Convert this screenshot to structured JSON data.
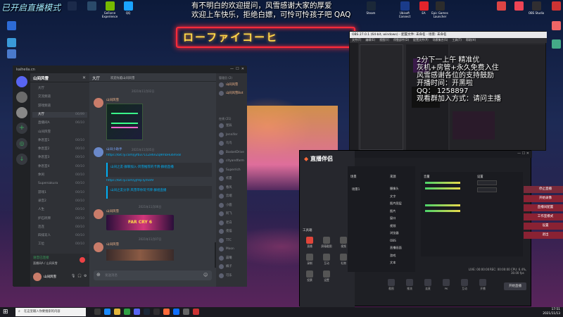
{
  "overlay": {
    "top_left": "已开启直播模式",
    "line1": "有不明白的欢迎提问，风雪感谢大家的厚爱",
    "line2": "欢迎上车快乐，拒绝白嫖，可怜可怜孩子吧 QAQ",
    "right": [
      "2分下一上午 精准优",
      "灰机+房管+永久免费入住",
      "风雪感谢各位的支持鼓励",
      "开播时间：开黑啦",
      "QQ：  1258897",
      "观看群加入方式：请问主播"
    ]
  },
  "desktop_icons": [
    "Steam",
    "Ubisoft Connect",
    "EA",
    "Epic Games Launcher",
    "OBS Studio",
    "GeForce Experience",
    "QQ"
  ],
  "neon_sign": "ローファイコーヒ",
  "discord": {
    "window_title": "kaiheila.cn",
    "server_name": "山间风雪",
    "channel_header": "大厅",
    "channel_topic": "欢迎光临山间风雪",
    "channels": [
      {
        "name": "大厅",
        "count": ""
      },
      {
        "name": "交流频道",
        "count": ""
      },
      {
        "name": "游戏频道",
        "count": ""
      },
      {
        "name": "大厅",
        "count": "06/99"
      },
      {
        "name": "直播间A",
        "count": "06/10"
      },
      {
        "name": "山间风雪",
        "count": ""
      },
      {
        "name": "休息室1",
        "count": "00/10"
      },
      {
        "name": "休息室2",
        "count": "00/10"
      },
      {
        "name": "休息室3",
        "count": "00/10"
      },
      {
        "name": "休息室4",
        "count": "00/10"
      },
      {
        "name": "休闲",
        "count": "00/10"
      },
      {
        "name": "Supersakura",
        "count": "00/10"
      },
      {
        "name": "游戏1",
        "count": "00/10"
      },
      {
        "name": "录音2",
        "count": "00/10"
      },
      {
        "name": "人生",
        "count": "00/10"
      },
      {
        "name": "炉石听牌",
        "count": "00/10"
      },
      {
        "name": "连连",
        "count": "00/10"
      },
      {
        "name": "四排双人",
        "count": "00/10"
      },
      {
        "name": "工位",
        "count": "00/10"
      }
    ],
    "voice_status": "语音已连接",
    "voice_channel": "直播间A / 山间风雪",
    "user_name": "山间风雪",
    "messages": [
      {
        "author": "山间风雪",
        "time": "2021年11月02日"
      },
      {
        "author": "山间小助手",
        "time": "2021年11月05日",
        "links": [
          "https://bit.ly.com/jyfb3711Ze6nZq9mbHu6mxB",
          "山间之友·群聊加入·风雪推荐的卡牌·群组直播",
          "https://bit.ly.com/yjfHpTymeI9",
          "山间之友分享·风雪带你玩卡牌·群组直播"
        ]
      },
      {
        "author": "山间风雪",
        "time": "2021年11月06日",
        "image_caption": "FAR CRY 6"
      },
      {
        "author": "山间风雪",
        "time": "2021年11月07日"
      }
    ],
    "input_placeholder": "发送消息",
    "members_header": "管理员 (2)",
    "online_header": "在线 (21)",
    "members": [
      "山间风雪",
      "山间风雪Bot",
      "星辰",
      "Jennifer",
      "鸟鸟",
      "BasketDrive",
      "cityandfarm",
      "Superrich",
      "初夏",
      "春风",
      "云端",
      "小鹿",
      "阿飞",
      "老白",
      "夜猫",
      "TTC",
      "Moon",
      "晨曦",
      "橘子",
      "可乐"
    ]
  },
  "obs": {
    "title": "OBS 27.0.1 (64-bit, windows) - 配置文件: 未命名 - 场景: 未命名",
    "menu": [
      "文件(F)",
      "编辑(E)",
      "视图(V)",
      "停靠部件(D)",
      "配置文件(P)",
      "场景集合(S)",
      "工具(T)",
      "帮助(H)"
    ]
  },
  "live": {
    "logo": "直播伴侣",
    "scene_header": "场景",
    "scenes": [
      "场景1"
    ],
    "sources_header": "来源",
    "sources": [
      "摄像头",
      "文字",
      "图片图层",
      "图片",
      "窗口",
      "视频",
      "浏览器",
      "OBS",
      "直播画面",
      "游戏",
      "文本"
    ],
    "tools_header": "工具箱",
    "tools": [
      "直播",
      "屏幕截图",
      "视频",
      "录制",
      "互动",
      "礼物",
      "投票",
      "设置"
    ],
    "audio_label": "音量",
    "param_label": "设置",
    "right_buttons": [
      "停止直播",
      "开始录像",
      "直播间配置",
      "工作室模式",
      "设置",
      "退出"
    ],
    "bottom_tools": [
      "截图",
      "推流",
      "连麦",
      "PK",
      "互动",
      "开播"
    ],
    "start_button": "开始直播",
    "status": [
      "LIVE: 00:00:00",
      "REC: 00:00:00",
      "CPU: 6.4%, 30.00 fps"
    ]
  },
  "taskbar": {
    "search_placeholder": "在这里输入你要搜索的内容",
    "time": "17:51",
    "date": "2021/11/13"
  },
  "colors": {
    "discord_bg": "#36393f",
    "discord_dark": "#202225",
    "accent_red": "#e03a3a",
    "neon_red": "#ff2a3a",
    "neon_yellow": "#ffd84a"
  }
}
